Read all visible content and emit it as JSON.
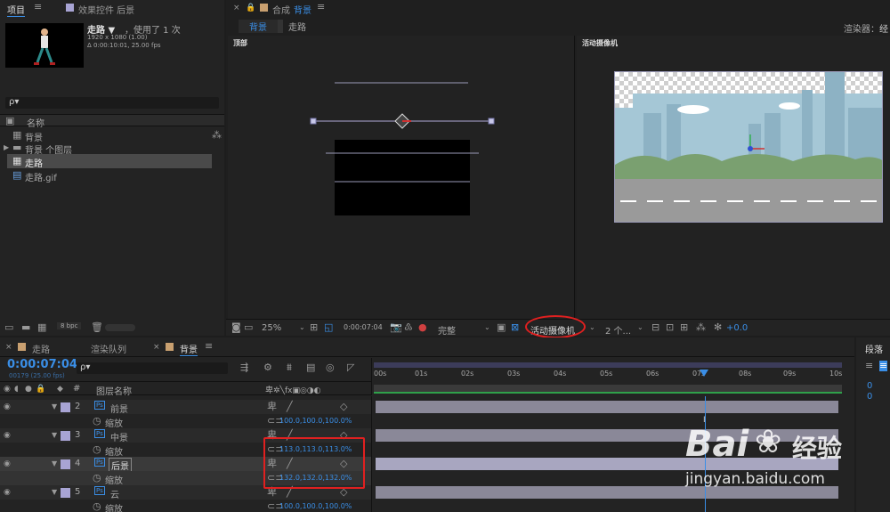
{
  "project_panel": {
    "tab_project": "项目",
    "tab_effects": "效果控件 后景",
    "menu_icon": "≡",
    "preview_name": "走路 ▼",
    "preview_used": "，使用了 1 次",
    "preview_size": "1920 x 1080 (1.00)",
    "preview_duration": "Δ 0:00:10:01, 25.00 fps",
    "search_placeholder": "ρ▾",
    "column_name": "名称",
    "items": [
      {
        "label": "背景",
        "icon": "composition-icon"
      },
      {
        "label": "背景 个图层",
        "icon": "folder-icon"
      },
      {
        "label": "走路",
        "icon": "composition-icon"
      },
      {
        "label": "走路.gif",
        "icon": "file-icon"
      }
    ],
    "bpc": "8 bpc"
  },
  "comp_panel": {
    "close": "×",
    "lock_icon": "🔒",
    "title_prefix": "合成",
    "title_name": "背景",
    "breadcrumb_active": "背景",
    "breadcrumb_next": "走路",
    "renderer_label": "渲染器：",
    "renderer_value": "经",
    "view_left": "顶部",
    "view_right": "活动摄像机",
    "toolbar": {
      "zoom": "25%",
      "timecode": "0:00:07:04",
      "resolution": "完整",
      "camera": "活动摄像机",
      "views": "2 个...",
      "exposure": "+0.0"
    }
  },
  "timeline_panel": {
    "tab_walk": "走路",
    "tab_render": "渲染队列",
    "tab_bg": "背景",
    "menu_icon": "≡",
    "timecode": "0:00:07:04",
    "frame_info": "00179 (25.00 fps)",
    "search_placeholder": "ρ▾",
    "col_hash": "#",
    "col_name": "图层名称",
    "ruler": [
      "00s",
      "01s",
      "02s",
      "03s",
      "04s",
      "05s",
      "06s",
      "07s",
      "08s",
      "09s",
      "10s"
    ],
    "layers": [
      {
        "num": "2",
        "name": "前景",
        "prop": "缩放",
        "value": "100.0,100.0,100.0%",
        "color": "#a8a4d4"
      },
      {
        "num": "3",
        "name": "中景",
        "prop": "缩放",
        "value": "113.0,113.0,113.0%",
        "color": "#a8a4d4"
      },
      {
        "num": "4",
        "name": "后景",
        "prop": "缩放",
        "value": "132.0,132.0,132.0%",
        "color": "#a8a4d4"
      },
      {
        "num": "5",
        "name": "云",
        "prop": "缩放",
        "value": "100.0,100.0,100.0%",
        "color": "#a8a4d4"
      }
    ]
  },
  "right_panel": {
    "tab": "段落",
    "val1": "0",
    "val2": "0"
  },
  "watermark": {
    "brand": "Bai",
    "brand2": "经验",
    "url": "jingyan.baidu.com"
  },
  "colors": {
    "accent": "#3a8ee6",
    "highlight_red": "#e02020",
    "label_lavender": "#a8a4d4",
    "sky": "#a5c7d6",
    "road": "#9a9a9a"
  }
}
